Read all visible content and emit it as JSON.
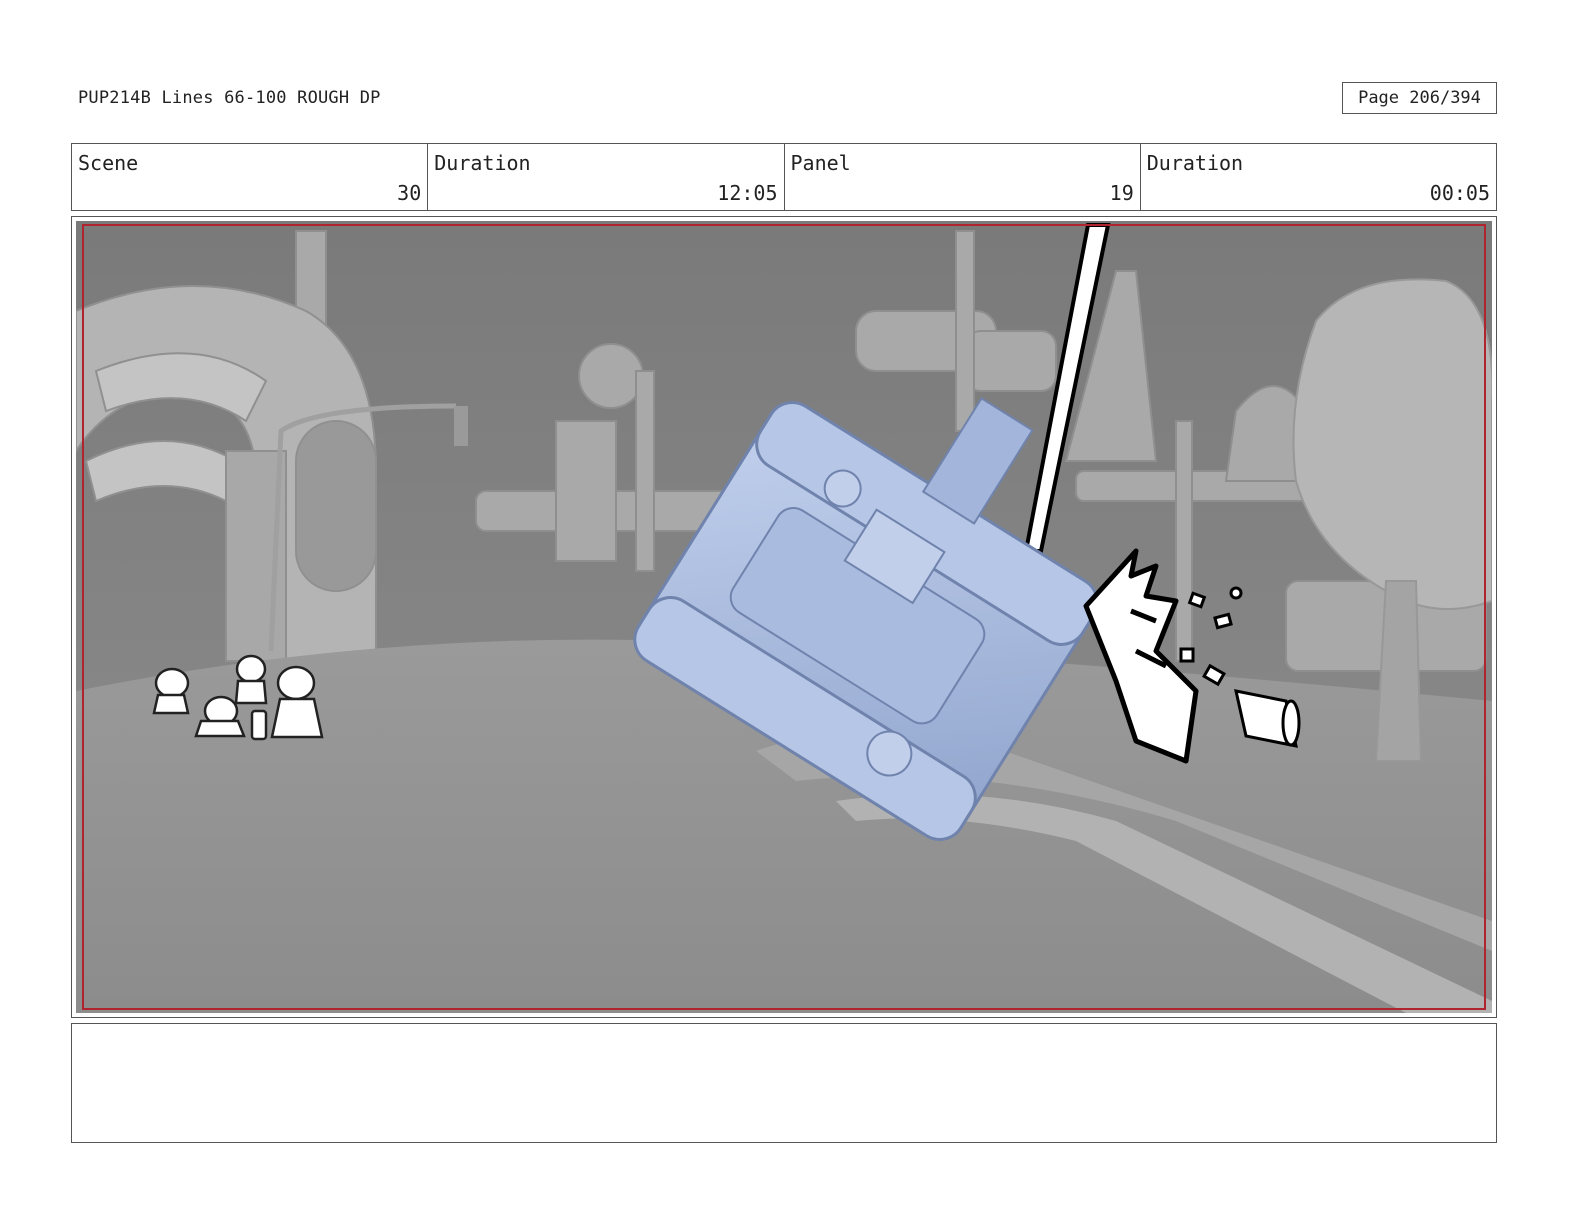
{
  "header": {
    "doc_title": "PUP214B Lines 66-100 ROUGH DP",
    "page_label": "Page 206/394"
  },
  "info": {
    "scene_label": "Scene",
    "scene_value": "30",
    "scene_duration_label": "Duration",
    "scene_duration_value": "12:05",
    "panel_label": "Panel",
    "panel_value": "19",
    "panel_duration_label": "Duration",
    "panel_duration_value": "00:05"
  },
  "colors": {
    "safe_frame": "#b0252d",
    "vehicle_tint": "#9fb3d8",
    "background_gray": "#8a8a8a"
  },
  "notes": {
    "text": ""
  }
}
